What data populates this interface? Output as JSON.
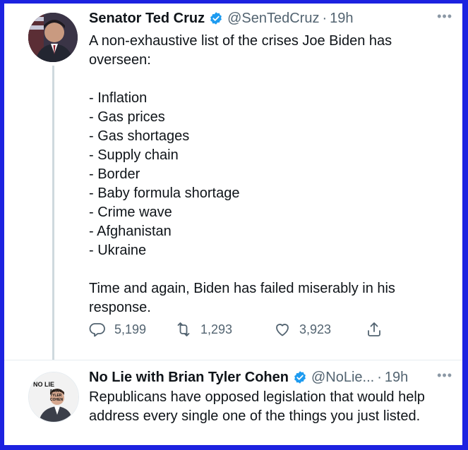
{
  "main_tweet": {
    "display_name": "Senator Ted Cruz",
    "handle": "@SenTedCruz",
    "separator": "·",
    "time": "19h",
    "text": "A non-exhaustive list of the crises Joe Biden has overseen:\n\n- Inflation\n- Gas prices\n- Gas shortages\n- Supply chain\n- Border\n- Baby formula shortage\n- Crime wave\n- Afghanistan\n- Ukraine\n\nTime and again, Biden has failed miserably in his response.",
    "replies": "5,199",
    "retweets": "1,293",
    "likes": "3,923"
  },
  "reply_tweet": {
    "display_name": "No Lie with Brian Tyler Cohen",
    "handle": "@NoLie...",
    "separator": "·",
    "time": "19h",
    "text": "Republicans have opposed legislation that would help address every single one of the things you just listed.",
    "avatar_text_1": "NO LIE",
    "avatar_text_2": "BRIAN TYLER COHEN"
  },
  "colors": {
    "frame": "#1c22e0",
    "verified": "#1d9bf0",
    "text": "#0f1419",
    "muted": "#536471"
  },
  "icons": [
    "verified-badge-icon",
    "more-icon",
    "reply-icon",
    "retweet-icon",
    "like-icon",
    "share-icon"
  ]
}
